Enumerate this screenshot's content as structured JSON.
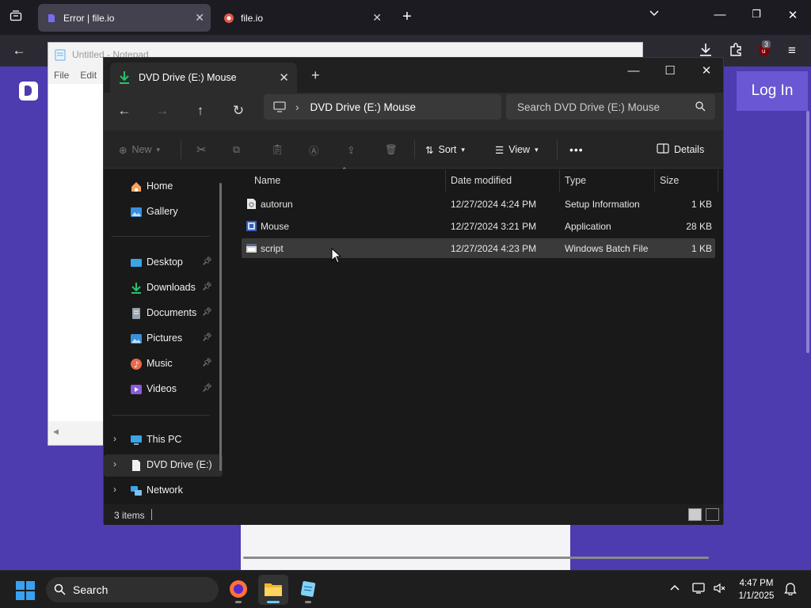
{
  "browser": {
    "tabs": [
      {
        "title": "Error | file.io",
        "active": true
      },
      {
        "title": "file.io",
        "active": false
      }
    ],
    "extension_badge": "3"
  },
  "page": {
    "login_label": "Log In"
  },
  "notepad": {
    "title": "Untitled - Notepad",
    "menu": [
      "File",
      "Edit"
    ]
  },
  "explorer": {
    "tab_title": "DVD Drive (E:) Mouse",
    "address": "DVD Drive (E:) Mouse",
    "search_placeholder": "Search DVD Drive (E:) Mouse",
    "commands": {
      "new": "New",
      "sort": "Sort",
      "view": "View",
      "more": "•••",
      "details": "Details"
    },
    "sidebar": {
      "home": "Home",
      "gallery": "Gallery",
      "desktop": "Desktop",
      "downloads": "Downloads",
      "documents": "Documents",
      "pictures": "Pictures",
      "music": "Music",
      "videos": "Videos",
      "this_pc": "This PC",
      "dvd": "DVD Drive (E:) Mouse",
      "network": "Network"
    },
    "columns": [
      "Name",
      "Date modified",
      "Type",
      "Size"
    ],
    "files": [
      {
        "name": "autorun",
        "date": "12/27/2024 4:24 PM",
        "type": "Setup Information",
        "size": "1 KB",
        "icon": "settings-file-icon"
      },
      {
        "name": "Mouse",
        "date": "12/27/2024 3:21 PM",
        "type": "Application",
        "size": "28 KB",
        "icon": "application-icon"
      },
      {
        "name": "script",
        "date": "12/27/2024 4:23 PM",
        "type": "Windows Batch File",
        "size": "1 KB",
        "icon": "batch-file-icon",
        "selected": true
      }
    ],
    "status": "3 items"
  },
  "taskbar": {
    "search_label": "Search",
    "time": "4:47 PM",
    "date": "1/1/2025"
  },
  "colors": {
    "page_purple": "#4d3bb0",
    "accent_blue": "#60cdff",
    "download_green": "#28c36f"
  }
}
